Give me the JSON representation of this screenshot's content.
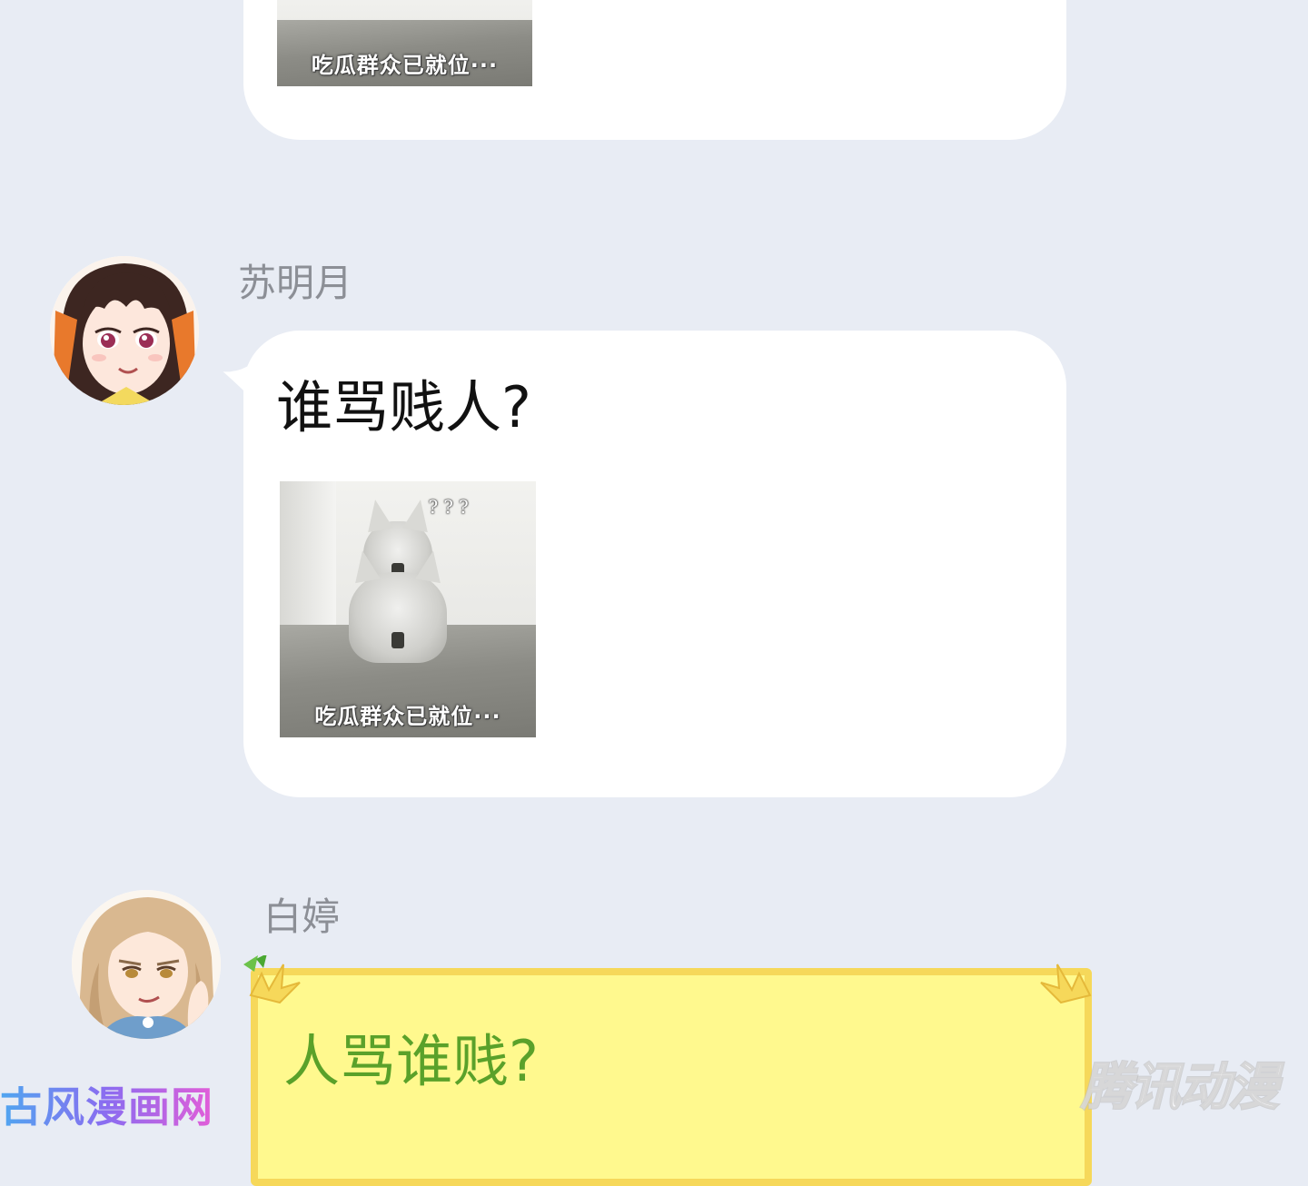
{
  "messages": [
    {
      "sticker_caption": "吃瓜群众已就位···"
    },
    {
      "sender": "苏明月",
      "avatar_icon": "girl-portrait-icon",
      "text": "谁骂贱人?",
      "sticker_caption": "吃瓜群众已就位···",
      "sticker_marks": "???"
    },
    {
      "sender": "白婷",
      "avatar_icon": "woman-portrait-icon",
      "text": "人骂谁贱?",
      "text_color": "#5aa12a"
    }
  ],
  "watermarks": {
    "left": "古风漫画网",
    "right": "腾讯动漫"
  },
  "colors": {
    "background": "#e8ecf4",
    "bubble": "#ffffff",
    "highlight_bubble": "#fff98e",
    "name": "#8c8f96"
  }
}
